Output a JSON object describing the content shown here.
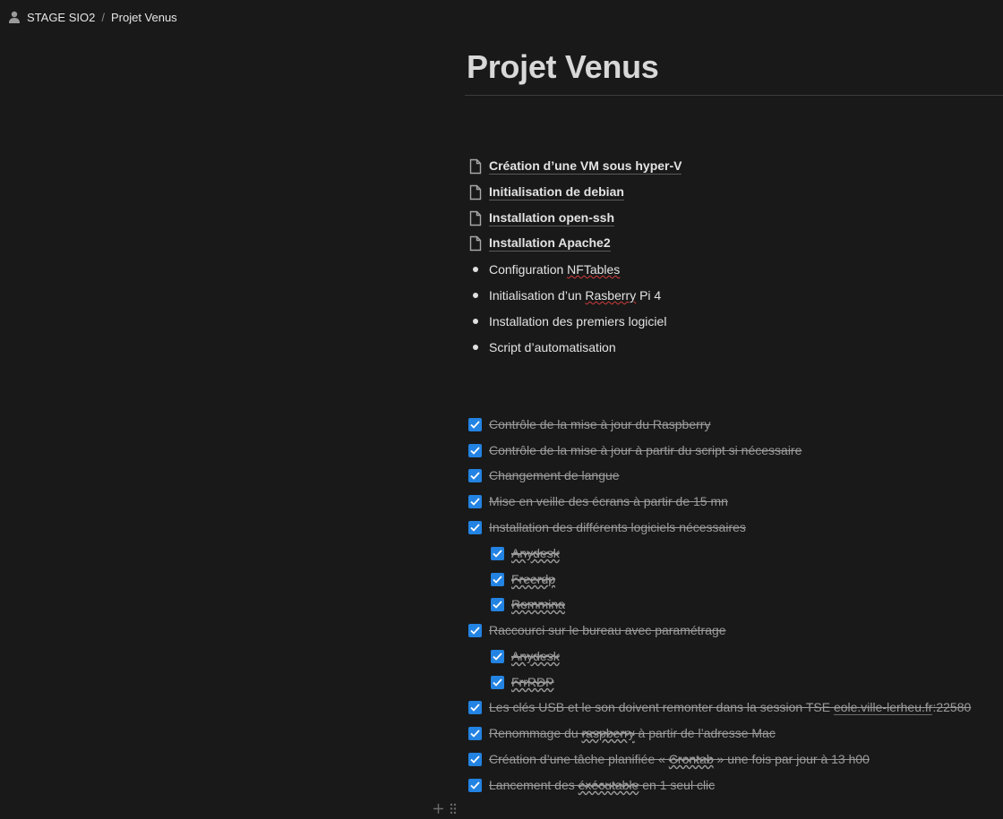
{
  "breadcrumb": {
    "icon": "person-icon",
    "items": [
      "STAGE SIO2",
      "Projet Venus"
    ],
    "separator": "/"
  },
  "page": {
    "title": "Projet Venus"
  },
  "sub_pages": [
    {
      "label": "Création d’une VM sous hyper-V",
      "icon": "page-icon"
    },
    {
      "label": "Initialisation de debian",
      "icon": "page-icon"
    },
    {
      "label": "Installation open-ssh",
      "icon": "page-icon"
    },
    {
      "label": "Installation Apache2",
      "icon": "page-icon"
    }
  ],
  "bullets": [
    {
      "before": "Configuration ",
      "spell": "NFTables",
      "after": ""
    },
    {
      "before": "Initialisation d’un ",
      "spell": "Rasberry",
      "after": " Pi 4"
    },
    {
      "before": "Installation des premiers logiciel",
      "spell": "",
      "after": ""
    },
    {
      "before": "Script d’automatisation",
      "spell": "",
      "after": ""
    }
  ],
  "todos": {
    "t1": "Contrôle de la mise à jour du Raspberry",
    "t2": "Contrôle de la mise à jour à partir du script si nécessaire",
    "t3": "Changement de langue",
    "t4": "Mise en veille des écrans à partir de 15 mn",
    "t5": "Installation des différents logiciels nécessaires",
    "t5a": "Anydesk",
    "t5b": "Freerdp",
    "t5c": "Remmina",
    "t6": "Raccourci sur le bureau avec paramétrage",
    "t6a": "Anydesk",
    "t6b": "FrrRDP",
    "t7_before": "Les clés USB et le son doivent remonter dans la session TSE ",
    "t7_link": "eole.ville-lerheu.fr",
    "t7_after": ":22580",
    "t8_before": "Renommage du ",
    "t8_spell": "raspberry",
    "t8_after": " à partir de l’adresse Mac",
    "t9_before": "Création d’une tâche planifiée « ",
    "t9_spell": "Crontab",
    "t9_after": " » une fois par jour à 13 h00",
    "t10_before": "Lancement des ",
    "t10_spell": "éxécutable",
    "t10_after": " en 1 seul clic",
    "checked": true
  },
  "block_handle": {
    "add_icon": "plus-icon",
    "drag_icon": "drag-handle-icon"
  },
  "colors": {
    "background": "#191919",
    "checkbox": "#2383e2",
    "text": "#e3e3e3",
    "done_text": "#9b9b9b"
  }
}
